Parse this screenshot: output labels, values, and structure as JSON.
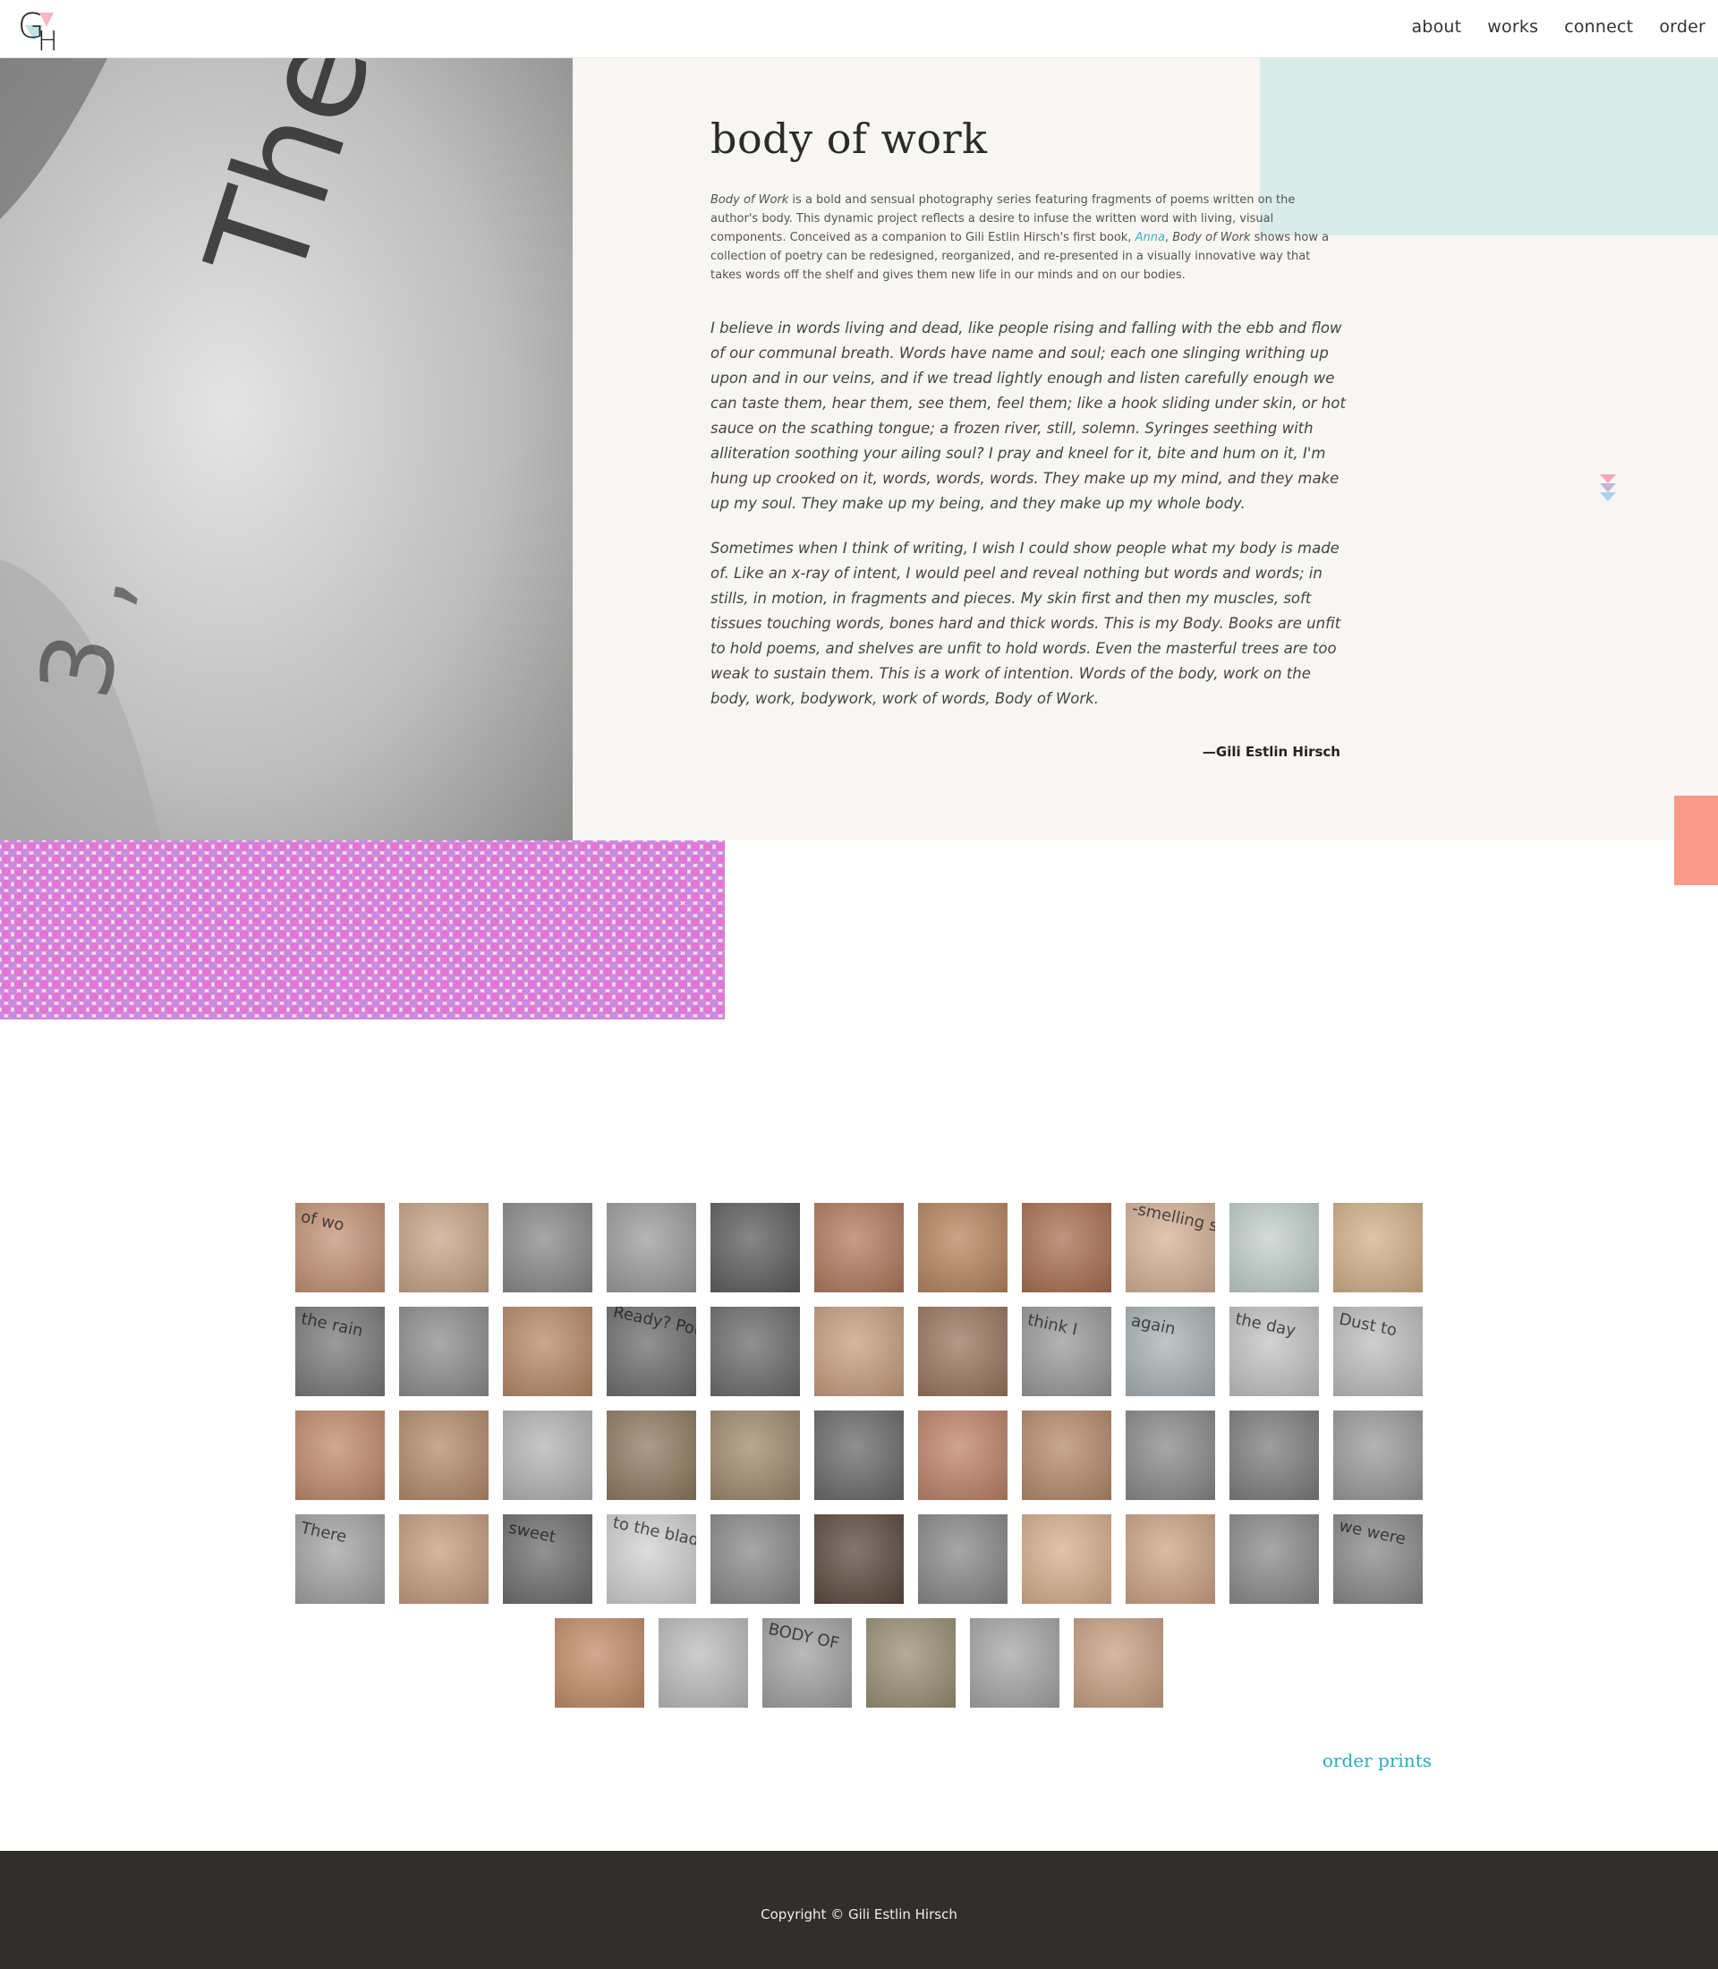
{
  "header": {
    "logo_letters": "GH",
    "nav": [
      {
        "label": "about"
      },
      {
        "label": "works"
      },
      {
        "label": "connect"
      },
      {
        "label": "order"
      }
    ]
  },
  "hero": {
    "photo_text": "The a sn si",
    "title": "body of work",
    "intro": {
      "em_title": "Body of Work",
      "part1": " is a bold and sensual photography series featuring fragments of poems written on the author's body. This dynamic project reflects a desire to infuse the written word with living, visual components. Conceived as a companion to Gili Estlin Hirsch's first book, ",
      "link": "Anna",
      "part2": ", ",
      "em_title2": "Body of Work",
      "part3": " shows how a collection of poetry can be redesigned, reorganized, and re-presented in a visually innovative way that takes words off the shelf and gives them new life in our minds and on our bodies."
    },
    "quote1": "I believe in words living and dead, like people rising and falling with the ebb and flow of our communal breath. Words have name and soul; each one slinging writhing up upon and in our veins, and if we tread lightly enough and listen carefully enough we can taste them, hear them, see them, feel them; like a hook sliding under skin, or hot sauce on the scathing tongue; a frozen river, still, solemn. Syringes seething with alliteration soothing your ailing soul? I pray and kneel for it, bite and hum on it, I'm hung up crooked on it, words, words, words. They make up my mind, and they make up my soul. They make up my being, and they make up my whole body.",
    "quote2": "Sometimes when I think of writing, I wish I could show people what my body is made of. Like an x-ray of intent, I would peel and reveal nothing but words and words; in stills, in motion, in fragments and pieces. My skin first and then my muscles, soft tissues touching words, bones hard and thick words. This is my Body. Books are unfit to hold poems, and shelves are unfit to hold words. Even the masterful trees are too weak to sustain them. This is a work of intention. Words of the body, work on the body, work, bodywork, work of words, Body of Work.",
    "attribution": "—Gili Estlin Hirsch"
  },
  "colors": {
    "accent": "#2aaebd",
    "mint": "#d9ecea",
    "coral": "#f8998a",
    "panel": "#f7f6f2",
    "footer": "#322e2c"
  },
  "gallery": {
    "rows": [
      [
        {
          "text": "of wo",
          "bg": "#c49377"
        },
        {
          "text": "",
          "bg": "#c9a58a"
        },
        {
          "text": "",
          "bg": "#8a8a8a"
        },
        {
          "text": "",
          "bg": "#9d9d9d"
        },
        {
          "text": "",
          "bg": "#5e5e5e"
        },
        {
          "text": "",
          "bg": "#b47a5e"
        },
        {
          "text": "",
          "bg": "#b8865f"
        },
        {
          "text": "",
          "bg": "#ab7052"
        },
        {
          "text": "-smelling stone",
          "bg": "#d7b398"
        },
        {
          "text": "",
          "bg": "#c3d0cb"
        },
        {
          "text": "",
          "bg": "#d4b28a"
        }
      ],
      [
        {
          "text": "the rain",
          "bg": "#7a7a7a"
        },
        {
          "text": "",
          "bg": "#8e8e8e"
        },
        {
          "text": "",
          "bg": "#b98a66"
        },
        {
          "text": "Ready? Pounce.",
          "bg": "#6e6e6e"
        },
        {
          "text": "",
          "bg": "#6c6c6c"
        },
        {
          "text": "",
          "bg": "#c99f7e"
        },
        {
          "text": "",
          "bg": "#9c7560"
        },
        {
          "text": "think I",
          "bg": "#9a9a9a"
        },
        {
          "text": "again",
          "bg": "#a9b3b6"
        },
        {
          "text": "the day",
          "bg": "#c4c4c4"
        },
        {
          "text": "Dust to",
          "bg": "#bfbfbf"
        }
      ],
      [
        {
          "text": "",
          "bg": "#c18b6b"
        },
        {
          "text": "",
          "bg": "#b68c6c"
        },
        {
          "text": "",
          "bg": "#b5b5b5"
        },
        {
          "text": "",
          "bg": "#8f7b61"
        },
        {
          "text": "",
          "bg": "#a08a6e"
        },
        {
          "text": "",
          "bg": "#6a6a6a"
        },
        {
          "text": "",
          "bg": "#c0836a"
        },
        {
          "text": "",
          "bg": "#b78a6b"
        },
        {
          "text": "",
          "bg": "#8a8a8a"
        },
        {
          "text": "",
          "bg": "#7e7e7e"
        },
        {
          "text": "",
          "bg": "#9b9b9b"
        }
      ],
      [
        {
          "text": "There",
          "bg": "#a4a4a4"
        },
        {
          "text": "",
          "bg": "#c79e7f"
        },
        {
          "text": "sweet",
          "bg": "#6e6e6e"
        },
        {
          "text": "to the blade",
          "bg": "#d2d2d2"
        },
        {
          "text": "",
          "bg": "#8a8a8a"
        },
        {
          "text": "",
          "bg": "#5d4a3f"
        },
        {
          "text": "",
          "bg": "#898989"
        },
        {
          "text": "",
          "bg": "#d9b08e"
        },
        {
          "text": "",
          "bg": "#cfa585"
        },
        {
          "text": "",
          "bg": "#8b8b8b"
        },
        {
          "text": "we were",
          "bg": "#8a8a8a"
        }
      ],
      [
        {
          "text": "",
          "bg": "#c48d69"
        },
        {
          "text": "",
          "bg": "#bdbdbd"
        },
        {
          "text": "BODY OF",
          "bg": "#a3a3a3"
        },
        {
          "text": "",
          "bg": "#9a9074"
        },
        {
          "text": "",
          "bg": "#a7a7a7"
        },
        {
          "text": "",
          "bg": "#c9a183"
        }
      ]
    ]
  },
  "order_link": "order prints",
  "footer": {
    "copyright": "Copyright © Gili Estlin Hirsch"
  }
}
